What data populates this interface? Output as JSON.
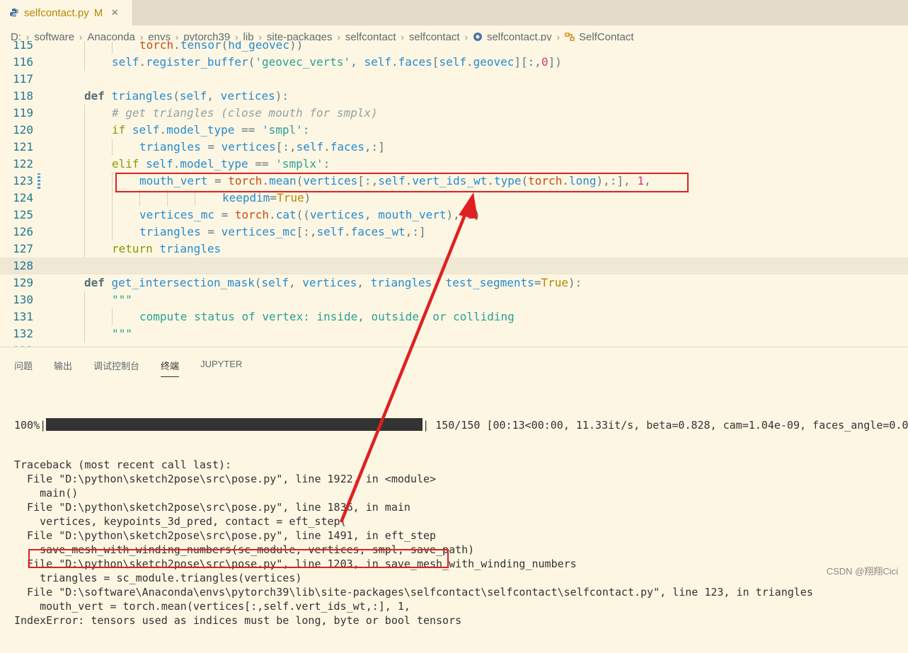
{
  "tab": {
    "filename": "selfcontact.py",
    "status": "M",
    "close": "×"
  },
  "breadcrumb": [
    "D:",
    "software",
    "Anaconda",
    "envs",
    "pytorch39",
    "lib",
    "site-packages",
    "selfcontact",
    "selfcontact",
    "selfcontact.py",
    "SelfContact"
  ],
  "editor": {
    "lines": [
      {
        "num": "115",
        "indent": 3,
        "html": "<span class=\"tc\">torch</span><span class=\"punc\">.</span><span class=\"fn\">tensor</span><span class=\"punc\">(</span>hd_geovec<span class=\"punc\">))</span>"
      },
      {
        "num": "116",
        "indent": 2,
        "html": "self<span class=\"punc\">.</span>register_buffer<span class=\"punc\">(</span><span class=\"str\">'geovec_verts'</span><span class=\"punc\">,</span> self<span class=\"punc\">.</span>faces<span class=\"punc\">[</span>self<span class=\"punc\">.</span>geovec<span class=\"punc\">][:,</span><span class=\"num\">0</span><span class=\"punc\">])</span>"
      },
      {
        "num": "117",
        "indent": 0,
        "html": ""
      },
      {
        "num": "118",
        "indent": 1,
        "html": "<span class=\"kw\">def</span> triangles<span class=\"punc\">(</span>self<span class=\"punc\">,</span> vertices<span class=\"punc\">):</span>"
      },
      {
        "num": "119",
        "indent": 2,
        "html": "<span class=\"cm\"># get triangles (close mouth for smplx)</span>"
      },
      {
        "num": "120",
        "indent": 2,
        "html": "<span class=\"kw\" style=\"font-weight:normal;color:#859900\">if</span> self<span class=\"punc\">.</span>model_type <span class=\"punc\">==</span> <span class=\"str\">'smpl'</span><span class=\"punc\">:</span>"
      },
      {
        "num": "121",
        "indent": 3,
        "html": "triangles <span class=\"punc\">=</span> vertices<span class=\"punc\">[:,</span>self<span class=\"punc\">.</span>faces<span class=\"punc\">,:]</span>"
      },
      {
        "num": "122",
        "indent": 2,
        "html": "<span class=\"kw\" style=\"font-weight:normal;color:#859900\">elif</span> self<span class=\"punc\">.</span>model_type <span class=\"punc\">==</span> <span class=\"str\">'smplx'</span><span class=\"punc\">:</span>"
      },
      {
        "num": "123",
        "indent": 3,
        "html": "mouth_vert <span class=\"punc\">=</span> <span class=\"tc\">torch</span><span class=\"punc\">.</span>mean<span class=\"punc\">(</span>vertices<span class=\"punc\">[:,</span>self<span class=\"punc\">.</span>vert_ids_wt<span class=\"punc\">.</span>type<span class=\"punc\">(</span><span class=\"tc\">torch</span><span class=\"punc\">.</span>long<span class=\"punc\">),:],</span> <span class=\"num\">1</span><span class=\"punc\">,</span>"
      },
      {
        "num": "124",
        "indent": 6,
        "html": "keepdim<span class=\"punc\">=</span><span class=\"bool\">True</span><span class=\"punc\">)</span>"
      },
      {
        "num": "125",
        "indent": 3,
        "html": "vertices_mc <span class=\"punc\">=</span> <span class=\"tc\">torch</span><span class=\"punc\">.</span>cat<span class=\"punc\">((</span>vertices<span class=\"punc\">,</span> mouth_vert<span class=\"punc\">),</span> <span class=\"num\">1</span><span class=\"punc\">)</span>"
      },
      {
        "num": "126",
        "indent": 3,
        "html": "triangles <span class=\"punc\">=</span> vertices_mc<span class=\"punc\">[:,</span>self<span class=\"punc\">.</span>faces_wt<span class=\"punc\">,:]</span>"
      },
      {
        "num": "127",
        "indent": 2,
        "html": "<span class=\"kw\" style=\"font-weight:normal;color:#859900\">return</span> triangles"
      },
      {
        "num": "128",
        "indent": 0,
        "html": ""
      },
      {
        "num": "129",
        "indent": 1,
        "html": "<span class=\"kw\">def</span> get_intersection_mask<span class=\"punc\">(</span>self<span class=\"punc\">,</span> vertices<span class=\"punc\">,</span> triangles<span class=\"punc\">,</span> test_segments<span class=\"punc\">=</span><span class=\"bool\">True</span><span class=\"punc\">):</span>"
      },
      {
        "num": "130",
        "indent": 2,
        "html": "<span class=\"str\">\"\"\"</span>"
      },
      {
        "num": "131",
        "indent": 3,
        "html": "<span class=\"str\">compute status of vertex: inside, outside, or colliding</span>"
      },
      {
        "num": "132",
        "indent": 2,
        "html": "<span class=\"str\">\"\"\"</span>"
      },
      {
        "num": "133",
        "indent": 0,
        "html": ""
      }
    ]
  },
  "panel": {
    "tabs": [
      "问题",
      "输出",
      "调试控制台",
      "终端",
      "JUPYTER"
    ],
    "active_tab": "终端",
    "progress": {
      "percent_label": "100%|",
      "fraction": 1.0,
      "suffix": "| 150/150 [00:13<00:00, 11.33it/s, beta=0.828, cam=1.04e-09, faces_angle=0.0,"
    },
    "terminal_lines": [
      "Traceback (most recent call last):",
      "  File \"D:\\python\\sketch2pose\\src\\pose.py\", line 1922, in <module>",
      "    main()",
      "  File \"D:\\python\\sketch2pose\\src\\pose.py\", line 1836, in main",
      "    vertices, keypoints_3d_pred, contact = eft_step(",
      "  File \"D:\\python\\sketch2pose\\src\\pose.py\", line 1491, in eft_step",
      "    save_mesh_with_winding_numbers(sc_module, vertices, smpl, save_path)",
      "  File \"D:\\python\\sketch2pose\\src\\pose.py\", line 1203, in save_mesh_with_winding_numbers",
      "    triangles = sc_module.triangles(vertices)",
      "  File \"D:\\software\\Anaconda\\envs\\pytorch39\\lib\\site-packages\\selfcontact\\selfcontact\\selfcontact.py\", line 123, in triangles",
      "    mouth_vert = torch.mean(vertices[:,self.vert_ids_wt,:], 1,",
      "IndexError: tensors used as indices must be long, byte or bool tensors"
    ]
  },
  "watermark": "CSDN @翔翔Cici",
  "colors": {
    "annotation": "#e02020",
    "accent": "#268bd2"
  }
}
